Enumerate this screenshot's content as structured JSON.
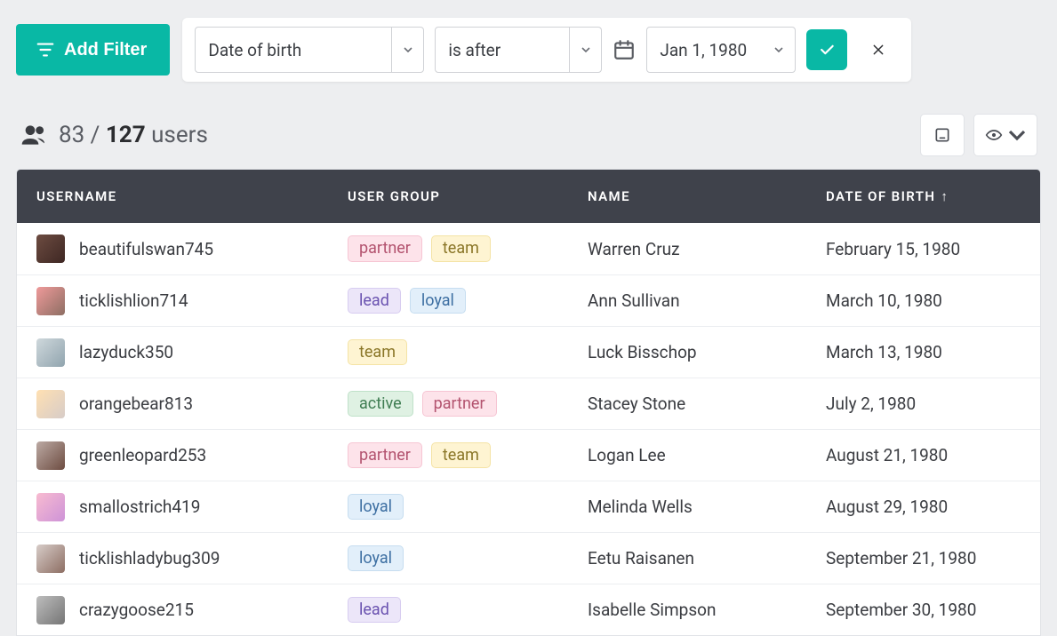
{
  "filter": {
    "add_label": "Add Filter",
    "field": "Date of birth",
    "operator": "is after",
    "value": "Jan 1, 1980"
  },
  "summary": {
    "filtered": "83",
    "of": " / ",
    "total": "127",
    "suffix": " users"
  },
  "columns": {
    "username": "USERNAME",
    "usergroup": "USER GROUP",
    "name": "NAME",
    "dob": "DATE OF BIRTH",
    "sort_arrow": "↑"
  },
  "tag_labels": {
    "partner": "partner",
    "team": "team",
    "lead": "lead",
    "loyal": "loyal",
    "active": "active"
  },
  "rows": [
    {
      "username": "beautifulswan745",
      "groups": [
        "partner",
        "team"
      ],
      "name": "Warren Cruz",
      "dob": "February 15, 1980",
      "a1": "#6d4c41",
      "a2": "#3e2723"
    },
    {
      "username": "ticklishlion714",
      "groups": [
        "lead",
        "loyal"
      ],
      "name": "Ann Sullivan",
      "dob": "March 10, 1980",
      "a1": "#ef9a9a",
      "a2": "#8d6e63"
    },
    {
      "username": "lazyduck350",
      "groups": [
        "team"
      ],
      "name": "Luck Bisschop",
      "dob": "March 13, 1980",
      "a1": "#cfd8dc",
      "a2": "#90a4ae"
    },
    {
      "username": "orangebear813",
      "groups": [
        "active",
        "partner"
      ],
      "name": "Stacey Stone",
      "dob": "July 2, 1980",
      "a1": "#ffe0b2",
      "a2": "#d7ccc8"
    },
    {
      "username": "greenleopard253",
      "groups": [
        "partner",
        "team"
      ],
      "name": "Logan Lee",
      "dob": "August 21, 1980",
      "a1": "#bcaaa4",
      "a2": "#6d4c41"
    },
    {
      "username": "smallostrich419",
      "groups": [
        "loyal"
      ],
      "name": "Melinda Wells",
      "dob": "August 29, 1980",
      "a1": "#f8bbd0",
      "a2": "#ce93d8"
    },
    {
      "username": "ticklishladybug309",
      "groups": [
        "loyal"
      ],
      "name": "Eetu Raisanen",
      "dob": "September 21, 1980",
      "a1": "#d7ccc8",
      "a2": "#8d6e63"
    },
    {
      "username": "crazygoose215",
      "groups": [
        "lead"
      ],
      "name": "Isabelle Simpson",
      "dob": "September 30, 1980",
      "a1": "#bdbdbd",
      "a2": "#757575"
    }
  ]
}
